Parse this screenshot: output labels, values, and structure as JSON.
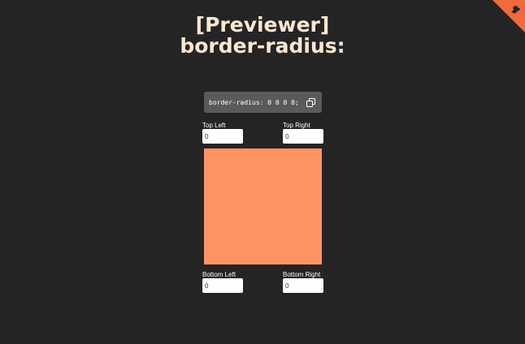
{
  "colors": {
    "background": "#242424",
    "title": "#ffe7d2",
    "accent": "#f26a3c",
    "preview": "#ff9463",
    "code_bg": "#5a5a5a"
  },
  "header": {
    "line1": "[Previewer]",
    "line2": "border-radius:"
  },
  "corner": {
    "icon": "github-icon"
  },
  "code": {
    "text": "border-radius: 0 0 0 0;",
    "copy_icon": "copy-icon"
  },
  "fields": {
    "top_left": {
      "label": "Top Left",
      "value": "0"
    },
    "top_right": {
      "label": "Top Right",
      "value": "0"
    },
    "bottom_left": {
      "label": "Bottom Left",
      "value": "0"
    },
    "bottom_right": {
      "label": "Bottom Right",
      "value": "0"
    }
  }
}
